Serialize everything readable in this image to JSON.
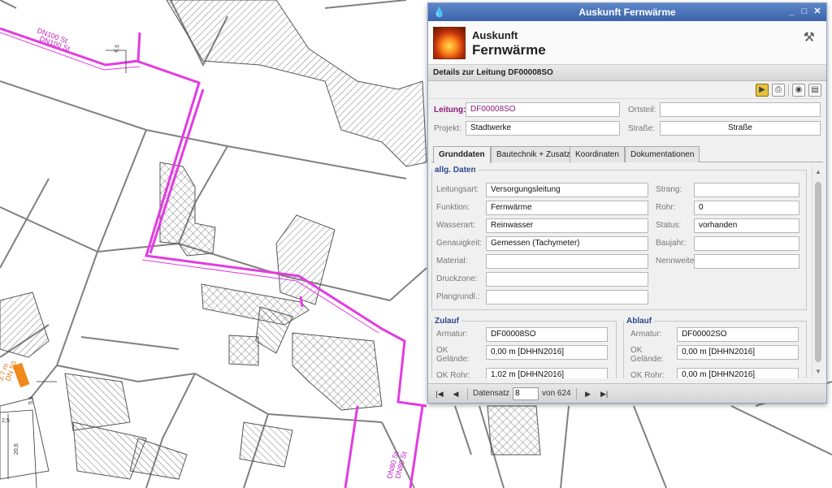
{
  "map": {
    "labels": {
      "top_left_1": "DN100 St",
      "top_left_2": "DN100 St",
      "bottom_1": "DN80 St",
      "bottom_2": "DN80 St",
      "dim_1": "6,5",
      "dim_2": "5,5",
      "dim_3": "2,5",
      "dim_4": "20,6",
      "orange_1": "3.7 m",
      "orange_2": "DN 50"
    },
    "colors": {
      "pipe": "#e23ce0",
      "lines": "#808080",
      "hatch": "#555555",
      "orange": "#f08a1c"
    }
  },
  "window": {
    "title": "Auskunft Fernwärme",
    "header": {
      "line1": "Auskunft",
      "line2": "Fernwärme"
    },
    "details_title": "Details zur Leitung DF00008SO",
    "top_fields": {
      "leitung_label": "Leitung:",
      "leitung_value": "DF00008SO",
      "ortsteil_label": "Ortsteil:",
      "ortsteil_value": "",
      "projekt_label": "Projekt:",
      "projekt_value": "Stadtwerke",
      "strasse_label": "Straße:",
      "strasse_value": "Straße"
    },
    "tabs": [
      {
        "label": "Grunddaten"
      },
      {
        "label": "Bautechnik + Zusatz"
      },
      {
        "label": "Koordinaten"
      },
      {
        "label": "Dokumentationen"
      }
    ],
    "allg": {
      "legend": "allg. Daten",
      "left": [
        {
          "label": "Leitungsart:",
          "value": "Versorgungsleitung"
        },
        {
          "label": "Funktion:",
          "value": "Fernwärme"
        },
        {
          "label": "Wasserart:",
          "value": "Reinwasser"
        },
        {
          "label": "Genauigkeit:",
          "value": "Gemessen (Tachymeter)"
        },
        {
          "label": "Material:",
          "value": ""
        },
        {
          "label": "Druckzone:",
          "value": ""
        },
        {
          "label": "Plangrundl.:",
          "value": ""
        }
      ],
      "right": [
        {
          "label": "Strang:",
          "value": ""
        },
        {
          "label": "Rohr:",
          "value": "0"
        },
        {
          "label": "Status:",
          "value": "vorhanden"
        },
        {
          "label": "Baujahr:",
          "value": ""
        },
        {
          "label": "Nennweite:",
          "value": ""
        }
      ]
    },
    "zulauf": {
      "legend": "Zulauf",
      "armatur_label": "Armatur:",
      "armatur_value": "DF00008SO",
      "ok_gelaende_label": "OK Gelände:",
      "ok_gelaende_value": "0,00 m [DHHN2016]",
      "ok_rohr_label": "OK Rohr:",
      "ok_rohr_value": "1,02 m [DHHN2016]"
    },
    "ablauf": {
      "legend": "Ablauf",
      "armatur_label": "Armatur:",
      "armatur_value": "DF00002SO",
      "ok_gelaende_label": "OK Gelände:",
      "ok_gelaende_value": "0,00 m [DHHN2016]",
      "ok_rohr_label": "OK Rohr:",
      "ok_rohr_value": "0,00 m [DHHN2016]"
    },
    "nav": {
      "datensatz_label": "Datensatz",
      "current": "8",
      "total_label": "von 624"
    },
    "icons": [
      "app-flame-icon",
      "tools-icon",
      "export-icon",
      "print-icon",
      "binoculars-icon",
      "document-icon"
    ]
  }
}
